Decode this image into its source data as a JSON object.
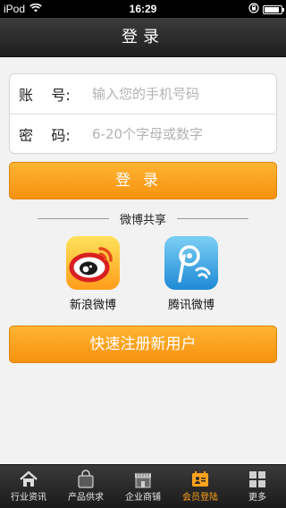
{
  "status_bar": {
    "carrier": "iPod",
    "time": "16:29",
    "battery_level": 0.9
  },
  "header": {
    "title": "登录"
  },
  "login_form": {
    "account_label": "账    号:",
    "account_placeholder": "输入您的手机号码",
    "password_label": "密    码:",
    "password_placeholder": "6-20个字母或数字"
  },
  "login_button": "登录",
  "share": {
    "title": "微博共享",
    "items": [
      {
        "label": "新浪微博",
        "icon": "sina-weibo-icon"
      },
      {
        "label": "腾讯微博",
        "icon": "tencent-weibo-icon"
      }
    ]
  },
  "register_button": "快速注册新用户",
  "tab_bar": {
    "items": [
      {
        "label": "行业资讯",
        "icon": "home-icon"
      },
      {
        "label": "产品供求",
        "icon": "shopping-bag-icon"
      },
      {
        "label": "企业商铺",
        "icon": "store-icon"
      },
      {
        "label": "会员登陆",
        "icon": "member-card-icon",
        "active": true
      },
      {
        "label": "更多",
        "icon": "grid-icon"
      }
    ]
  },
  "colors": {
    "accent": "#f6920f",
    "active_tab": "#ffa21c",
    "title_bar": "#2a2a2a"
  }
}
